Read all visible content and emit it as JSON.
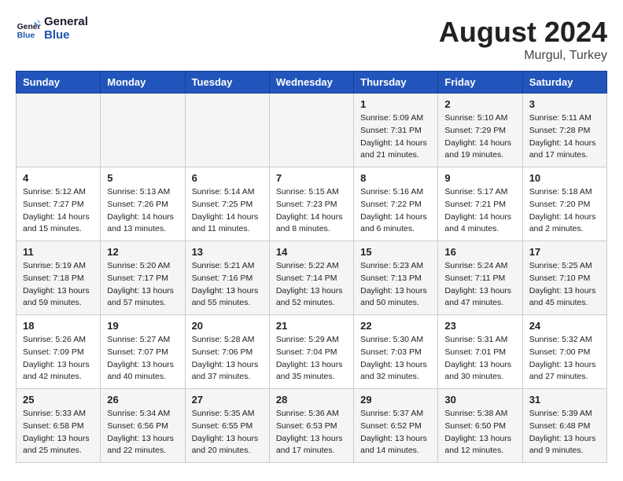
{
  "header": {
    "logo_general": "General",
    "logo_blue": "Blue",
    "month_year": "August 2024",
    "location": "Murgul, Turkey"
  },
  "weekdays": [
    "Sunday",
    "Monday",
    "Tuesday",
    "Wednesday",
    "Thursday",
    "Friday",
    "Saturday"
  ],
  "weeks": [
    [
      {
        "day": "",
        "info": ""
      },
      {
        "day": "",
        "info": ""
      },
      {
        "day": "",
        "info": ""
      },
      {
        "day": "",
        "info": ""
      },
      {
        "day": "1",
        "info": "Sunrise: 5:09 AM\nSunset: 7:31 PM\nDaylight: 14 hours\nand 21 minutes."
      },
      {
        "day": "2",
        "info": "Sunrise: 5:10 AM\nSunset: 7:29 PM\nDaylight: 14 hours\nand 19 minutes."
      },
      {
        "day": "3",
        "info": "Sunrise: 5:11 AM\nSunset: 7:28 PM\nDaylight: 14 hours\nand 17 minutes."
      }
    ],
    [
      {
        "day": "4",
        "info": "Sunrise: 5:12 AM\nSunset: 7:27 PM\nDaylight: 14 hours\nand 15 minutes."
      },
      {
        "day": "5",
        "info": "Sunrise: 5:13 AM\nSunset: 7:26 PM\nDaylight: 14 hours\nand 13 minutes."
      },
      {
        "day": "6",
        "info": "Sunrise: 5:14 AM\nSunset: 7:25 PM\nDaylight: 14 hours\nand 11 minutes."
      },
      {
        "day": "7",
        "info": "Sunrise: 5:15 AM\nSunset: 7:23 PM\nDaylight: 14 hours\nand 8 minutes."
      },
      {
        "day": "8",
        "info": "Sunrise: 5:16 AM\nSunset: 7:22 PM\nDaylight: 14 hours\nand 6 minutes."
      },
      {
        "day": "9",
        "info": "Sunrise: 5:17 AM\nSunset: 7:21 PM\nDaylight: 14 hours\nand 4 minutes."
      },
      {
        "day": "10",
        "info": "Sunrise: 5:18 AM\nSunset: 7:20 PM\nDaylight: 14 hours\nand 2 minutes."
      }
    ],
    [
      {
        "day": "11",
        "info": "Sunrise: 5:19 AM\nSunset: 7:18 PM\nDaylight: 13 hours\nand 59 minutes."
      },
      {
        "day": "12",
        "info": "Sunrise: 5:20 AM\nSunset: 7:17 PM\nDaylight: 13 hours\nand 57 minutes."
      },
      {
        "day": "13",
        "info": "Sunrise: 5:21 AM\nSunset: 7:16 PM\nDaylight: 13 hours\nand 55 minutes."
      },
      {
        "day": "14",
        "info": "Sunrise: 5:22 AM\nSunset: 7:14 PM\nDaylight: 13 hours\nand 52 minutes."
      },
      {
        "day": "15",
        "info": "Sunrise: 5:23 AM\nSunset: 7:13 PM\nDaylight: 13 hours\nand 50 minutes."
      },
      {
        "day": "16",
        "info": "Sunrise: 5:24 AM\nSunset: 7:11 PM\nDaylight: 13 hours\nand 47 minutes."
      },
      {
        "day": "17",
        "info": "Sunrise: 5:25 AM\nSunset: 7:10 PM\nDaylight: 13 hours\nand 45 minutes."
      }
    ],
    [
      {
        "day": "18",
        "info": "Sunrise: 5:26 AM\nSunset: 7:09 PM\nDaylight: 13 hours\nand 42 minutes."
      },
      {
        "day": "19",
        "info": "Sunrise: 5:27 AM\nSunset: 7:07 PM\nDaylight: 13 hours\nand 40 minutes."
      },
      {
        "day": "20",
        "info": "Sunrise: 5:28 AM\nSunset: 7:06 PM\nDaylight: 13 hours\nand 37 minutes."
      },
      {
        "day": "21",
        "info": "Sunrise: 5:29 AM\nSunset: 7:04 PM\nDaylight: 13 hours\nand 35 minutes."
      },
      {
        "day": "22",
        "info": "Sunrise: 5:30 AM\nSunset: 7:03 PM\nDaylight: 13 hours\nand 32 minutes."
      },
      {
        "day": "23",
        "info": "Sunrise: 5:31 AM\nSunset: 7:01 PM\nDaylight: 13 hours\nand 30 minutes."
      },
      {
        "day": "24",
        "info": "Sunrise: 5:32 AM\nSunset: 7:00 PM\nDaylight: 13 hours\nand 27 minutes."
      }
    ],
    [
      {
        "day": "25",
        "info": "Sunrise: 5:33 AM\nSunset: 6:58 PM\nDaylight: 13 hours\nand 25 minutes."
      },
      {
        "day": "26",
        "info": "Sunrise: 5:34 AM\nSunset: 6:56 PM\nDaylight: 13 hours\nand 22 minutes."
      },
      {
        "day": "27",
        "info": "Sunrise: 5:35 AM\nSunset: 6:55 PM\nDaylight: 13 hours\nand 20 minutes."
      },
      {
        "day": "28",
        "info": "Sunrise: 5:36 AM\nSunset: 6:53 PM\nDaylight: 13 hours\nand 17 minutes."
      },
      {
        "day": "29",
        "info": "Sunrise: 5:37 AM\nSunset: 6:52 PM\nDaylight: 13 hours\nand 14 minutes."
      },
      {
        "day": "30",
        "info": "Sunrise: 5:38 AM\nSunset: 6:50 PM\nDaylight: 13 hours\nand 12 minutes."
      },
      {
        "day": "31",
        "info": "Sunrise: 5:39 AM\nSunset: 6:48 PM\nDaylight: 13 hours\nand 9 minutes."
      }
    ]
  ]
}
